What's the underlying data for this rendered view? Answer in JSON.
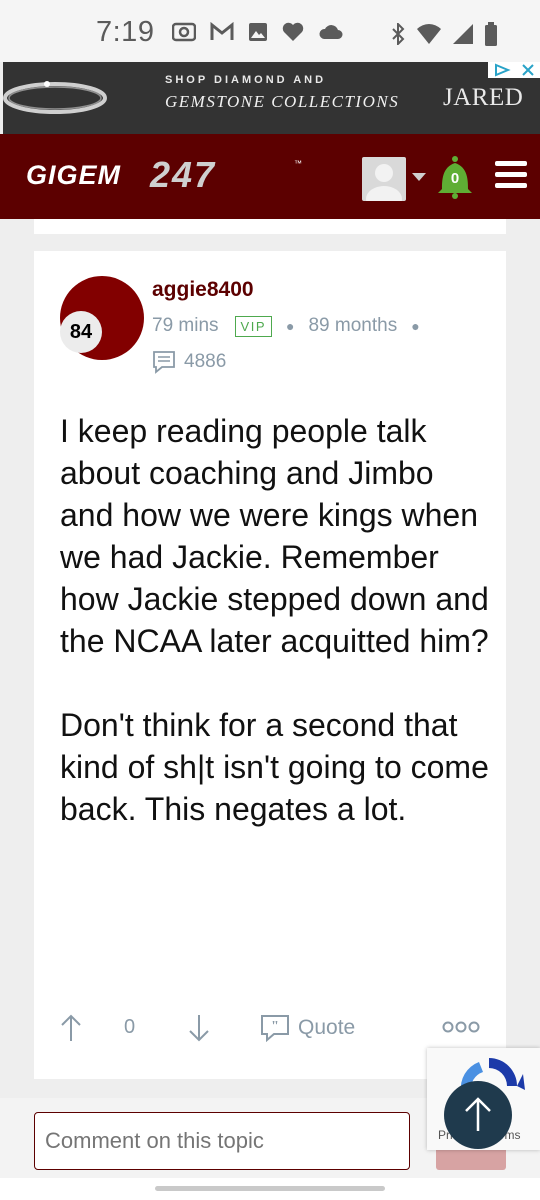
{
  "status_bar": {
    "time": "7:19",
    "left_icons": [
      "camera-icon",
      "gmail-icon",
      "image-icon",
      "heart-icon",
      "cloud-icon"
    ],
    "right_icons": [
      "bluetooth-icon",
      "wifi-icon",
      "signal-icon",
      "battery-icon"
    ]
  },
  "ad": {
    "line1": "SHOP DIAMOND AND",
    "line2": "GEMSTONE COLLECTIONS",
    "brand": "JARED"
  },
  "header": {
    "logo": "GIGEM247",
    "notification_count": "0",
    "colors": {
      "brand": "#5c0000",
      "bell": "#5fae34"
    }
  },
  "post": {
    "rank": "84",
    "username": "aggie8400",
    "time_ago": "79 mins",
    "badge": "VIP",
    "member_for": "89 months",
    "post_count": "4886",
    "body_paragraph_1": "I keep reading people talk about coaching and Jimbo and how we were kings when we had Jackie. Remember how Jackie stepped down and the NCAA later acquitted him?",
    "body_paragraph_2": "Don't think for a second that kind of sh|t isn't going to come back. This negates a lot.",
    "votes": "0",
    "quote_label": "Quote"
  },
  "comment": {
    "placeholder": "Comment on this topic"
  },
  "recaptcha": {
    "text": "Privacy - Terms"
  }
}
